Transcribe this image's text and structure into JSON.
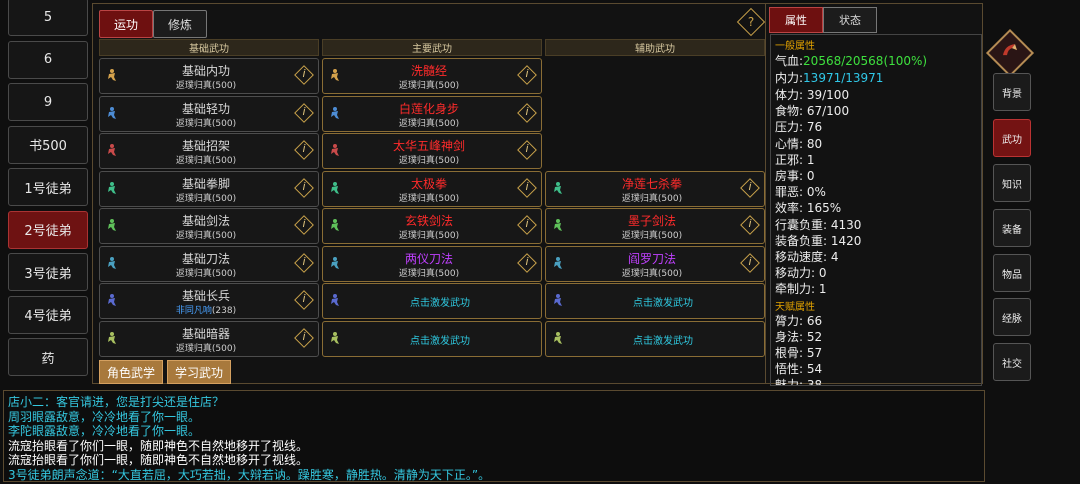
{
  "left_list": {
    "items": [
      {
        "label": "5",
        "active": false
      },
      {
        "label": "6",
        "active": false
      },
      {
        "label": "9",
        "active": false
      },
      {
        "label": "书500",
        "active": false
      },
      {
        "label": "1号徒弟",
        "active": false
      },
      {
        "label": "2号徒弟",
        "active": true
      },
      {
        "label": "3号徒弟",
        "active": false
      },
      {
        "label": "4号徒弟",
        "active": false
      },
      {
        "label": "药",
        "active": false
      }
    ]
  },
  "center": {
    "tabs": [
      {
        "label": "运功"
      },
      {
        "label": "修炼"
      }
    ],
    "help": "?",
    "columns": {
      "basic": "基础武功",
      "main": "主要武功",
      "aux": "辅助武功"
    },
    "info_glyph": "i",
    "basic": [
      {
        "name": "基础内功",
        "sub": "返璞归真(500)",
        "icon_color": "#d4a24c"
      },
      {
        "name": "基础轻功",
        "sub": "返璞归真(500)",
        "icon_color": "#4d8cd4"
      },
      {
        "name": "基础招架",
        "sub": "返璞归真(500)",
        "icon_color": "#c94a4a"
      },
      {
        "name": "基础拳脚",
        "sub": "返璞归真(500)",
        "icon_color": "#3fbf8a"
      },
      {
        "name": "基础剑法",
        "sub": "返璞归真(500)",
        "icon_color": "#5fc05a"
      },
      {
        "name": "基础刀法",
        "sub": "返璞归真(500)",
        "icon_color": "#4aa0c0"
      },
      {
        "name": "基础长兵",
        "sub_name": "非同凡响",
        "sub_value": "(238)",
        "icon_color": "#5a6ad0"
      },
      {
        "name": "基础暗器",
        "sub": "返璞归真(500)",
        "icon_color": "#a8c060"
      }
    ],
    "main": [
      {
        "name": "洗髓经",
        "sub": "返璞归真(500)",
        "name_color": "#ff2b2b",
        "icon_color": "#d4a24c"
      },
      {
        "name": "白莲化身步",
        "sub": "返璞归真(500)",
        "name_color": "#ff2b2b",
        "icon_color": "#4d8cd4"
      },
      {
        "name": "太华五峰神剑",
        "sub": "返璞归真(500)",
        "name_color": "#ff2b2b",
        "icon_color": "#c94a4a"
      },
      {
        "name": "太极拳",
        "sub": "返璞归真(500)",
        "name_color": "#ff2b2b",
        "icon_color": "#3fbf8a"
      },
      {
        "name": "玄铁剑法",
        "sub": "返璞归真(500)",
        "name_color": "#ff2b2b",
        "icon_color": "#5fc05a"
      },
      {
        "name": "两仪刀法",
        "sub": "返璞归真(500)",
        "name_color": "#c040ff",
        "icon_color": "#4aa0c0"
      },
      {
        "trigger": "点击激发武功",
        "icon_color": "#5a6ad0"
      },
      {
        "trigger": "点击激发武功",
        "icon_color": "#a8c060"
      }
    ],
    "aux": [
      {
        "name": "净莲七杀拳",
        "sub": "返璞归真(500)",
        "name_color": "#ff2b2b",
        "icon_color": "#3fbf8a"
      },
      {
        "name": "墨子剑法",
        "sub": "返璞归真(500)",
        "name_color": "#ff2b2b",
        "icon_color": "#5fc05a"
      },
      {
        "name": "阎罗刀法",
        "sub": "返璞归真(500)",
        "name_color": "#c040ff",
        "icon_color": "#4aa0c0"
      },
      {
        "trigger": "点击激发武功",
        "icon_color": "#5a6ad0"
      },
      {
        "trigger": "点击激发武功",
        "icon_color": "#a8c060"
      }
    ],
    "buttons": {
      "role": "角色武学",
      "learn": "学习武功"
    }
  },
  "attributes": {
    "tabs": [
      {
        "label": "属性"
      },
      {
        "label": "状态"
      }
    ],
    "general_title": "一般属性",
    "hp": {
      "label": "气血:",
      "value": "20568/20568(100%)"
    },
    "mp": {
      "label": "内力:",
      "value": "13971/13971"
    },
    "rows": [
      "体力: 39/100",
      "食物: 67/100",
      "压力: 76",
      "心情: 80",
      "正邪: 1",
      "房事: 0",
      "罪恶: 0%",
      "效率: 165%",
      "行囊负重: 4130",
      "装备负重: 1420",
      "移动速度: 4",
      "移动力: 0",
      "牵制力: 1"
    ],
    "talent_title": "天赋属性",
    "talent_rows": [
      "膂力: 66",
      "身法: 52",
      "根骨: 57",
      "悟性: 54",
      "魅力: 38"
    ],
    "partial_row": "福缘: 55"
  },
  "nav": {
    "items": [
      {
        "label": "背景",
        "active": false
      },
      {
        "label": "武功",
        "active": true
      },
      {
        "label": "知识",
        "active": false
      },
      {
        "label": "装备",
        "active": false
      },
      {
        "label": "物品",
        "active": false
      },
      {
        "label": "经脉",
        "active": false
      },
      {
        "label": "社交",
        "active": false
      }
    ]
  },
  "log": {
    "lines": [
      {
        "text": "店小二：客官请进，您是打尖还是住店？",
        "color": "#35c8e0"
      },
      {
        "text": "周羽眼露敌意，冷冷地看了你一眼。",
        "color": "#35c8e0"
      },
      {
        "text": "李陀眼露敌意，冷冷地看了你一眼。",
        "color": "#35c8e0"
      },
      {
        "text": "流寇抬眼看了你们一眼，随即神色不自然地移开了视线。",
        "color": "#ffffff"
      },
      {
        "text": "流寇抬眼看了你们一眼，随即神色不自然地移开了视线。",
        "color": "#ffffff"
      },
      {
        "speaker": "3号徒弟朗声念道：",
        "quote": "“大直若屈，大巧若拙，大辩若讷。躁胜寒，静胜热。清静为天下正。”。",
        "color": "#35c8e0"
      }
    ]
  }
}
